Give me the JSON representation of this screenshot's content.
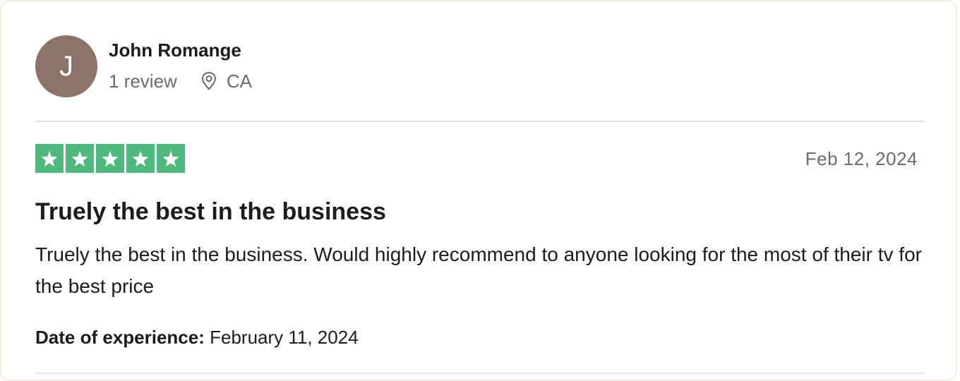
{
  "reviewer": {
    "initial": "J",
    "name": "John Romange",
    "review_count": "1 review",
    "location_icon": "location-pin-icon",
    "location": "CA",
    "avatar_color": "#8c7268"
  },
  "rating": {
    "stars": 5,
    "max_stars": 5,
    "star_color": "#4fb97d",
    "star_icon": "star-icon"
  },
  "review": {
    "date": "Feb 12, 2024",
    "title": "Truely the best in the business",
    "body": "Truely the best in the business. Would highly recommend to anyone looking for the most of their tv for the best price",
    "experience_label": "Date of experience:",
    "experience_date": "February 11, 2024"
  }
}
